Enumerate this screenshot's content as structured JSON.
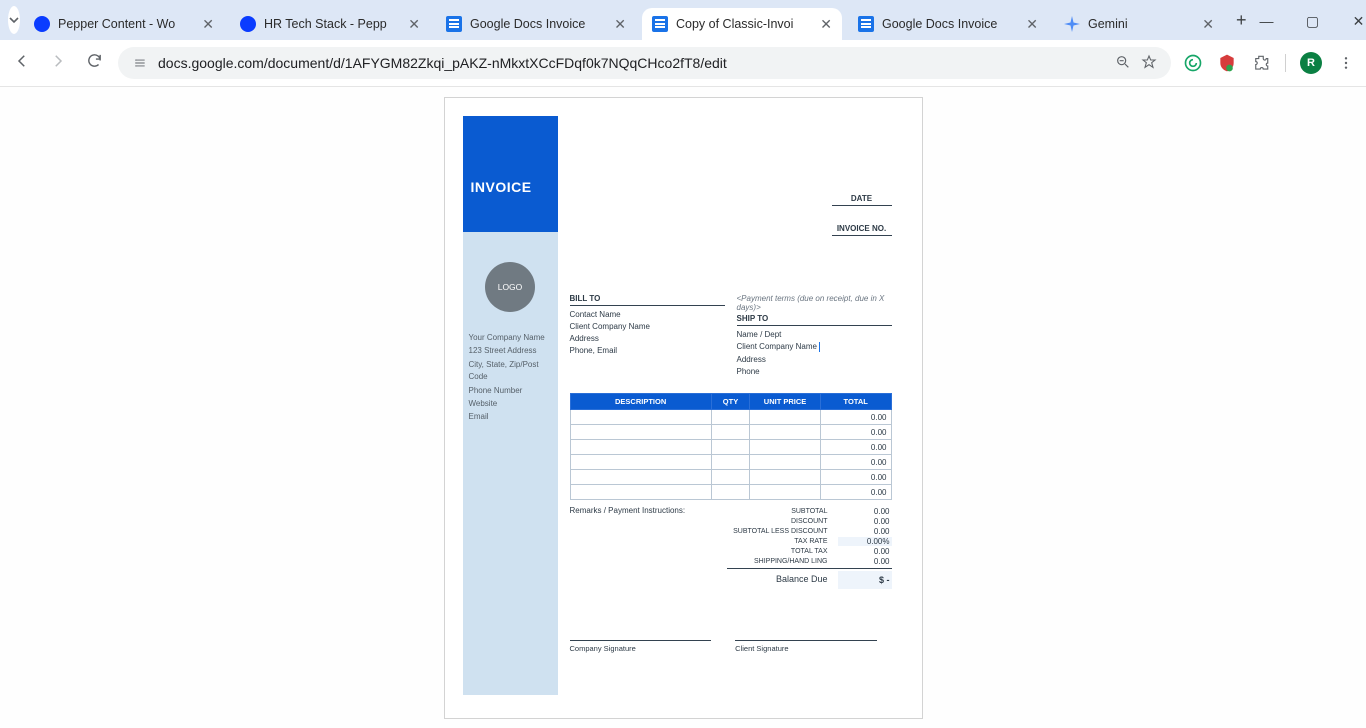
{
  "window": {
    "min_icon": "—",
    "max_icon": "▢",
    "close_icon": "✕"
  },
  "tabs": [
    {
      "title": "Pepper Content - Wo",
      "fav": "pepper"
    },
    {
      "title": "HR Tech Stack - Pepp",
      "fav": "pepper"
    },
    {
      "title": "Google Docs Invoice",
      "fav": "docs"
    },
    {
      "title": "Copy of Classic-Invoi",
      "fav": "docs"
    },
    {
      "title": "Google Docs Invoice",
      "fav": "docs"
    },
    {
      "title": "Gemini",
      "fav": "gemstar"
    }
  ],
  "active_tab_index": 3,
  "toolbar": {
    "url": "docs.google.com/document/d/1AFYGM82Zkqi_pAKZ-nMkxtXCcFDqf0k7NQqCHco2fT8/edit",
    "avatar_letter": "R"
  },
  "invoice": {
    "heading": "INVOICE",
    "logo_label": "LOGO",
    "company": {
      "name": "Your Company Name",
      "street": "123 Street Address",
      "csz": "City, State, Zip/Post Code",
      "phone": "Phone Number",
      "website": "Website",
      "email": "Email"
    },
    "meta": {
      "date_label": "DATE",
      "invno_label": "INVOICE NO."
    },
    "payment_terms": "<Payment terms (due on receipt, due in X days)>",
    "bill_to": {
      "heading": "BILL TO",
      "contact": "Contact Name",
      "company": "Client Company Name",
      "address": "Address",
      "phone_email": "Phone, Email"
    },
    "ship_to": {
      "heading": "SHIP TO",
      "name_dept": "Name / Dept",
      "company": "Client Company Name",
      "address": "Address",
      "phone": "Phone"
    },
    "table": {
      "headers": {
        "desc": "DESCRIPTION",
        "qty": "QTY",
        "unit": "UNIT PRICE",
        "total": "TOTAL"
      },
      "rows": [
        {
          "total": "0.00"
        },
        {
          "total": "0.00"
        },
        {
          "total": "0.00"
        },
        {
          "total": "0.00"
        },
        {
          "total": "0.00"
        },
        {
          "total": "0.00"
        }
      ]
    },
    "remarks_label": "Remarks / Payment Instructions:",
    "totals": {
      "subtotal": {
        "l": "SUBTOTAL",
        "v": "0.00"
      },
      "discount": {
        "l": "DISCOUNT",
        "v": "0.00"
      },
      "sub_less": {
        "l": "SUBTOTAL LESS DISCOUNT",
        "v": "0.00"
      },
      "tax_rate": {
        "l": "TAX RATE",
        "v": "0.00%"
      },
      "total_tax": {
        "l": "TOTAL TAX",
        "v": "0.00"
      },
      "shipping": {
        "l": "SHIPPING/HAND LING",
        "v": "0.00"
      },
      "balance": {
        "l": "Balance Due",
        "v": "$ -"
      }
    },
    "signatures": {
      "company": "Company Signature",
      "client": "Client Signature"
    }
  }
}
